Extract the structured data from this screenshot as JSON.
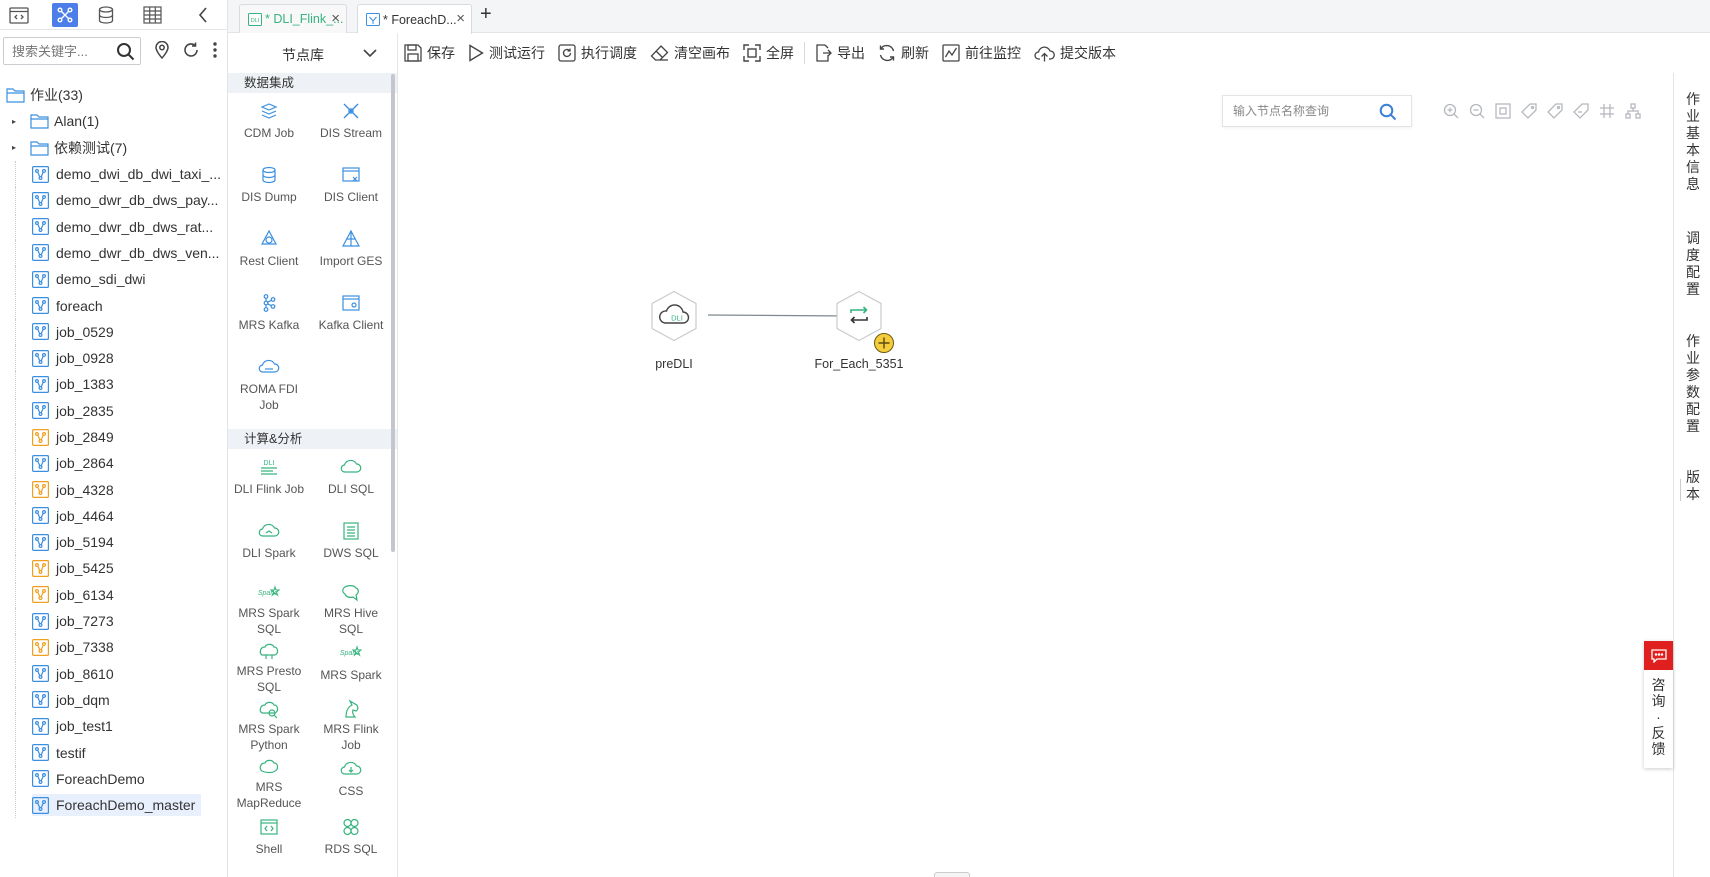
{
  "left_panel": {
    "search": {
      "placeholder": "搜索关键字..."
    },
    "tree_root": {
      "label": "作业(33)"
    },
    "tree_items": [
      {
        "label": "Alan(1)",
        "kind": "folder"
      },
      {
        "label": "依赖测试(7)",
        "kind": "folder"
      },
      {
        "label": "demo_dwi_db_dwi_taxi_...",
        "kind": "job"
      },
      {
        "label": "demo_dwr_db_dws_pay...",
        "kind": "job"
      },
      {
        "label": "demo_dwr_db_dws_rat...",
        "kind": "job"
      },
      {
        "label": "demo_dwr_db_dws_ven...",
        "kind": "job"
      },
      {
        "label": "demo_sdi_dwi",
        "kind": "job"
      },
      {
        "label": "foreach",
        "kind": "job"
      },
      {
        "label": "job_0529",
        "kind": "job"
      },
      {
        "label": "job_0928",
        "kind": "job"
      },
      {
        "label": "job_1383",
        "kind": "job"
      },
      {
        "label": "job_2835",
        "kind": "job"
      },
      {
        "label": "job_2849",
        "kind": "job-warn"
      },
      {
        "label": "job_2864",
        "kind": "job"
      },
      {
        "label": "job_4328",
        "kind": "job-warn"
      },
      {
        "label": "job_4464",
        "kind": "job"
      },
      {
        "label": "job_5194",
        "kind": "job"
      },
      {
        "label": "job_5425",
        "kind": "job-warn"
      },
      {
        "label": "job_6134",
        "kind": "job-warn"
      },
      {
        "label": "job_7273",
        "kind": "job"
      },
      {
        "label": "job_7338",
        "kind": "job-warn"
      },
      {
        "label": "job_8610",
        "kind": "job"
      },
      {
        "label": "job_dqm",
        "kind": "job"
      },
      {
        "label": "job_test1",
        "kind": "job"
      },
      {
        "label": "testif",
        "kind": "job"
      },
      {
        "label": "ForeachDemo",
        "kind": "job"
      },
      {
        "label": "ForeachDemo_master",
        "kind": "job",
        "selected": true
      }
    ]
  },
  "node_library": {
    "title": "节点库",
    "categories": [
      {
        "label": "数据集成",
        "items": [
          {
            "label": "CDM Job"
          },
          {
            "label": "DIS Stream"
          },
          {
            "label": "DIS Dump"
          },
          {
            "label": "DIS Client"
          },
          {
            "label": "Rest Client"
          },
          {
            "label": "Import GES"
          },
          {
            "label": "MRS Kafka"
          },
          {
            "label": "Kafka Client"
          },
          {
            "label": "ROMA FDI Job"
          }
        ]
      },
      {
        "label": "计算&分析",
        "items": [
          {
            "label": "DLI Flink Job"
          },
          {
            "label": "DLI SQL"
          },
          {
            "label": "DLI Spark"
          },
          {
            "label": "DWS SQL"
          },
          {
            "label": "MRS Spark SQL"
          },
          {
            "label": "MRS Hive SQL"
          },
          {
            "label": "MRS Presto SQL"
          },
          {
            "label": "MRS Spark"
          },
          {
            "label": "MRS Spark Python"
          },
          {
            "label": "MRS Flink Job"
          },
          {
            "label": "MRS MapReduce"
          },
          {
            "label": "CSS"
          },
          {
            "label": "Shell"
          },
          {
            "label": "RDS SQL"
          }
        ]
      }
    ]
  },
  "file_tabs": [
    {
      "label": "* DLI_Flink_...",
      "active": false,
      "icon": "DLI"
    },
    {
      "label": "* ForeachD...",
      "active": true,
      "icon": "flow"
    }
  ],
  "toolbar": {
    "save": "保存",
    "test_run": "测试运行",
    "schedule": "执行调度",
    "clear": "清空画布",
    "fullscreen": "全屏",
    "export": "导出",
    "refresh": "刷新",
    "monitor": "前往监控",
    "submit": "提交版本"
  },
  "canvas": {
    "search_placeholder": "输入节点名称查询",
    "nodes": [
      {
        "label": "preDLI",
        "icon_text": "DLI"
      },
      {
        "label": "For_Each_5351"
      }
    ]
  },
  "right_panel": {
    "tabs": [
      "作业基本信息",
      "调度配置",
      "作业参数配置",
      "版本"
    ]
  },
  "consult": {
    "label": "咨询·反馈"
  },
  "colors": {
    "accent": "#4d7de8",
    "icon_blue": "#3b8fe0",
    "icon_warn": "#f0a020",
    "green": "#36b37e",
    "consult_red": "#e0201e"
  }
}
